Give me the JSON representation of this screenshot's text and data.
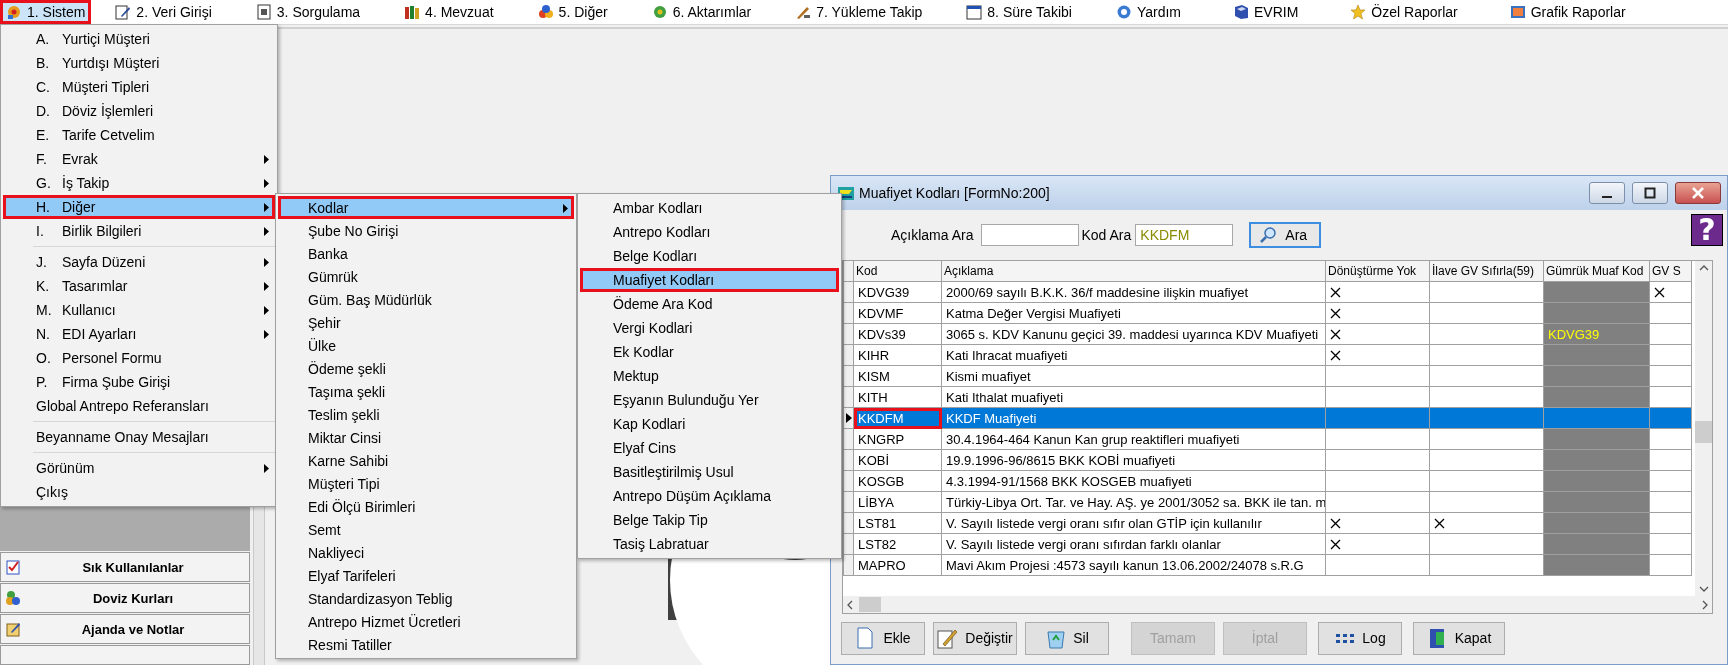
{
  "menubar": [
    {
      "label": "1. Sistem",
      "highlighted": true
    },
    {
      "label": "2. Veri Girişi",
      "highlighted": false
    },
    {
      "label": "3. Sorgulama",
      "highlighted": false
    },
    {
      "label": "4. Mevzuat",
      "highlighted": false
    },
    {
      "label": "5. Diğer",
      "highlighted": false
    },
    {
      "label": "6. Aktarımlar",
      "highlighted": false
    },
    {
      "label": "7. Yükleme Takip",
      "highlighted": false
    },
    {
      "label": "8. Süre Takibi",
      "highlighted": false
    },
    {
      "label": "Yardım",
      "highlighted": false
    },
    {
      "label": "EVRIM",
      "highlighted": false
    },
    {
      "label": "Özel Raporlar",
      "highlighted": false
    },
    {
      "label": "Grafik Raporlar",
      "highlighted": false
    }
  ],
  "left_panel": {
    "shortcuts": [
      {
        "label": "Sık Kullanılanlar"
      },
      {
        "label": "Doviz Kurları"
      },
      {
        "label": "Ajanda ve Notlar"
      }
    ]
  },
  "main_menu": {
    "items": [
      {
        "kind": "item",
        "key": "A.",
        "label": "Yurtiçi Müşteri",
        "submenu": false,
        "selected": false,
        "highlighted": false
      },
      {
        "kind": "item",
        "key": "B.",
        "label": "Yurtdışı Müşteri",
        "submenu": false,
        "selected": false,
        "highlighted": false
      },
      {
        "kind": "item",
        "key": "C.",
        "label": "Müşteri Tipleri",
        "submenu": false,
        "selected": false,
        "highlighted": false
      },
      {
        "kind": "item",
        "key": "D.",
        "label": "Döviz İşlemleri",
        "submenu": false,
        "selected": false,
        "highlighted": false
      },
      {
        "kind": "item",
        "key": "E.",
        "label": "Tarife Cetvelim",
        "submenu": false,
        "selected": false,
        "highlighted": false
      },
      {
        "kind": "item",
        "key": "F.",
        "label": "Evrak",
        "submenu": true,
        "selected": false,
        "highlighted": false
      },
      {
        "kind": "item",
        "key": "G.",
        "label": "İş Takip",
        "submenu": true,
        "selected": false,
        "highlighted": false
      },
      {
        "kind": "item",
        "key": "H.",
        "label": "Diğer",
        "submenu": true,
        "selected": true,
        "highlighted": true
      },
      {
        "kind": "item",
        "key": "I.",
        "label": "Birlik Bilgileri",
        "submenu": true,
        "selected": false,
        "highlighted": false
      },
      {
        "kind": "separator"
      },
      {
        "kind": "item",
        "key": "J.",
        "label": "Sayfa Düzeni",
        "submenu": true,
        "selected": false,
        "highlighted": false
      },
      {
        "kind": "item",
        "key": "K.",
        "label": "Tasarımlar",
        "submenu": true,
        "selected": false,
        "highlighted": false
      },
      {
        "kind": "item",
        "key": "M.",
        "label": "Kullanıcı",
        "submenu": true,
        "selected": false,
        "highlighted": false
      },
      {
        "kind": "item",
        "key": "N.",
        "label": "EDI Ayarları",
        "submenu": true,
        "selected": false,
        "highlighted": false
      },
      {
        "kind": "item",
        "key": "O.",
        "label": "Personel Formu",
        "submenu": false,
        "selected": false,
        "highlighted": false
      },
      {
        "kind": "item",
        "key": "P.",
        "label": "Firma Şube Girişi",
        "submenu": false,
        "selected": false,
        "highlighted": false
      },
      {
        "kind": "item",
        "label": "Global Antrepo Referansları",
        "submenu": false,
        "selected": false,
        "highlighted": false
      },
      {
        "kind": "separator"
      },
      {
        "kind": "item",
        "label": "Beyanname Onay Mesajları",
        "submenu": false,
        "selected": false,
        "highlighted": false
      },
      {
        "kind": "separator"
      },
      {
        "kind": "item",
        "label": "Görünüm",
        "submenu": true,
        "selected": false,
        "highlighted": false
      },
      {
        "kind": "item",
        "label": "Çıkış",
        "submenu": false,
        "selected": false,
        "highlighted": false
      }
    ]
  },
  "diger_menu": {
    "items": [
      {
        "label": "Kodlar",
        "submenu": true,
        "selected": true,
        "highlighted": true
      },
      {
        "label": "Şube No Girişi",
        "submenu": false,
        "selected": false,
        "highlighted": false
      },
      {
        "label": "Banka",
        "submenu": false,
        "selected": false,
        "highlighted": false
      },
      {
        "label": "Gümrük",
        "submenu": false,
        "selected": false,
        "highlighted": false
      },
      {
        "label": "Güm. Baş Müdürlük",
        "submenu": false,
        "selected": false,
        "highlighted": false
      },
      {
        "label": "Şehir",
        "submenu": false,
        "selected": false,
        "highlighted": false
      },
      {
        "label": "Ülke",
        "submenu": false,
        "selected": false,
        "highlighted": false
      },
      {
        "label": "Ödeme şekli",
        "submenu": false,
        "selected": false,
        "highlighted": false
      },
      {
        "label": "Taşıma şekli",
        "submenu": false,
        "selected": false,
        "highlighted": false
      },
      {
        "label": "Teslim şekli",
        "submenu": false,
        "selected": false,
        "highlighted": false
      },
      {
        "label": "Miktar Cinsi",
        "submenu": false,
        "selected": false,
        "highlighted": false
      },
      {
        "label": "Karne Sahibi",
        "submenu": false,
        "selected": false,
        "highlighted": false
      },
      {
        "label": "Müşteri  Tipi",
        "submenu": false,
        "selected": false,
        "highlighted": false
      },
      {
        "label": "Edi Ölçü Birimleri",
        "submenu": false,
        "selected": false,
        "highlighted": false
      },
      {
        "label": "Semt",
        "submenu": false,
        "selected": false,
        "highlighted": false
      },
      {
        "label": "Nakliyeci",
        "submenu": false,
        "selected": false,
        "highlighted": false
      },
      {
        "label": "Elyaf Tarifeleri",
        "submenu": false,
        "selected": false,
        "highlighted": false
      },
      {
        "label": "Standardizasyon Teblig",
        "submenu": false,
        "selected": false,
        "highlighted": false
      },
      {
        "label": "Antrepo Hizmet Ücretleri",
        "submenu": false,
        "selected": false,
        "highlighted": false
      },
      {
        "label": "Resmi Tatiller",
        "submenu": false,
        "selected": false,
        "highlighted": false
      }
    ]
  },
  "kodlar_menu": {
    "items": [
      {
        "label": "Ambar Kodları",
        "selected": false,
        "highlighted": false
      },
      {
        "label": "Antrepo Kodları",
        "selected": false,
        "highlighted": false
      },
      {
        "label": "Belge Kodları",
        "selected": false,
        "highlighted": false
      },
      {
        "label": "Muafiyet Kodları",
        "selected": true,
        "highlighted": true
      },
      {
        "label": "Ödeme Ara Kod",
        "selected": false,
        "highlighted": false
      },
      {
        "label": "Vergi Kodlari",
        "selected": false,
        "highlighted": false
      },
      {
        "label": "Ek Kodlar",
        "selected": false,
        "highlighted": false
      },
      {
        "label": "Mektup",
        "selected": false,
        "highlighted": false
      },
      {
        "label": "Eşyanın Bulunduğu Yer",
        "selected": false,
        "highlighted": false
      },
      {
        "label": "Kap Kodlari",
        "selected": false,
        "highlighted": false
      },
      {
        "label": "Elyaf Cins",
        "selected": false,
        "highlighted": false
      },
      {
        "label": "Basitleştirilmiş Usul",
        "selected": false,
        "highlighted": false
      },
      {
        "label": "Antrepo Düşüm Açıklama",
        "selected": false,
        "highlighted": false
      },
      {
        "label": "Belge Takip Tip",
        "selected": false,
        "highlighted": false
      },
      {
        "label": "Tasiş Labratuar",
        "selected": false,
        "highlighted": false
      }
    ]
  },
  "window": {
    "title": "Muafiyet Kodları [FormNo:200]",
    "search": {
      "description_label": "Açıklama Ara",
      "code_label": "Kod Ara",
      "code_value": "KKDFM",
      "button": "Ara"
    },
    "help_button": "?",
    "grid": {
      "columns": [
        {
          "label": "Kod",
          "readonly": false
        },
        {
          "label": "Açıklama",
          "readonly": false
        },
        {
          "label": "Dönüştürme Yok",
          "readonly": false
        },
        {
          "label": "İlave GV Sıfırla(59)",
          "readonly": false
        },
        {
          "label": "Gümrük Muaf Kod",
          "readonly": true
        },
        {
          "label": "GV S",
          "readonly": false
        }
      ],
      "rows": [
        {
          "kod": "KDVG39",
          "aciklama": "2000/69 sayılı B.K.K. 36/f maddesine ilişkin muafiyet",
          "donusturme_yok": true,
          "ilave_gv_sifirla": false,
          "gv_s": true,
          "selected": false,
          "highlighted": false
        },
        {
          "kod": "KDVMF",
          "aciklama": "Katma Değer Vergisi Muafiyeti",
          "donusturme_yok": true,
          "ilave_gv_sifirla": false,
          "gv_s": false,
          "selected": false,
          "highlighted": false
        },
        {
          "kod": "KDVs39",
          "aciklama": "3065 s. KDV Kanunu geçici 39. maddesi uyarınca KDV Muafiyeti",
          "donusturme_yok": true,
          "ilave_gv_sifirla": false,
          "gumruk_muaf_kod": "KDVG39",
          "gv_s": false,
          "selected": false,
          "highlighted": false
        },
        {
          "kod": "KIHR",
          "aciklama": "Kati Ihracat muafiyeti",
          "donusturme_yok": true,
          "ilave_gv_sifirla": false,
          "gv_s": false,
          "selected": false,
          "highlighted": false
        },
        {
          "kod": "KISM",
          "aciklama": "Kismi muafiyet",
          "donusturme_yok": false,
          "ilave_gv_sifirla": false,
          "gv_s": false,
          "selected": false,
          "highlighted": false
        },
        {
          "kod": "KITH",
          "aciklama": "Kati Ithalat muafiyeti",
          "donusturme_yok": false,
          "ilave_gv_sifirla": false,
          "gv_s": false,
          "selected": false,
          "highlighted": false
        },
        {
          "kod": "KKDFM",
          "aciklama": "KKDF Muafiyeti",
          "donusturme_yok": false,
          "ilave_gv_sifirla": false,
          "gv_s": false,
          "selected": true,
          "highlighted": true
        },
        {
          "kod": "KNGRP",
          "aciklama": "30.4.1964-464 Kanun Kan grup reaktifleri muafiyeti",
          "donusturme_yok": false,
          "ilave_gv_sifirla": false,
          "gv_s": false,
          "selected": false,
          "highlighted": false
        },
        {
          "kod": "KOBİ",
          "aciklama": "19.9.1996-96/8615 BKK KOBİ muafiyeti",
          "donusturme_yok": false,
          "ilave_gv_sifirla": false,
          "gv_s": false,
          "selected": false,
          "highlighted": false
        },
        {
          "kod": "KOSGB",
          "aciklama": "4.3.1994-91/1568 BKK KOSGEB muafiyeti",
          "donusturme_yok": false,
          "ilave_gv_sifirla": false,
          "gv_s": false,
          "selected": false,
          "highlighted": false
        },
        {
          "kod": "LİBYA",
          "aciklama": "Türkiy-Libya Ort. Tar. ve Hay. AŞ. ye 2001/3052 sa. BKK ile tan. m",
          "donusturme_yok": false,
          "ilave_gv_sifirla": false,
          "gv_s": false,
          "selected": false,
          "highlighted": false
        },
        {
          "kod": "LST81",
          "aciklama": "V. Sayılı listede vergi oranı sıfır olan GTİP için kullanılır",
          "donusturme_yok": true,
          "ilave_gv_sifirla": true,
          "gv_s": false,
          "selected": false,
          "highlighted": false
        },
        {
          "kod": "LST82",
          "aciklama": "V. Sayılı listede vergi oranı sıfırdan farklı olanlar",
          "donusturme_yok": true,
          "ilave_gv_sifirla": false,
          "gv_s": false,
          "selected": false,
          "highlighted": false
        },
        {
          "kod": "MAPRO",
          "aciklama": "Mavi Akım Projesi :4573 sayılı kanun 13.06.2002/24078 s.R.G",
          "donusturme_yok": false,
          "ilave_gv_sifirla": false,
          "gv_s": false,
          "selected": false,
          "highlighted": false
        }
      ]
    },
    "buttons": [
      {
        "label": "Ekle",
        "disabled": false
      },
      {
        "label": "Değiştir",
        "disabled": false
      },
      {
        "label": "Sil",
        "disabled": false
      },
      {
        "label": "Tamam",
        "disabled": true
      },
      {
        "label": "İptal",
        "disabled": true
      },
      {
        "label": "Log",
        "disabled": false
      },
      {
        "label": "Kapat",
        "disabled": false
      }
    ]
  }
}
